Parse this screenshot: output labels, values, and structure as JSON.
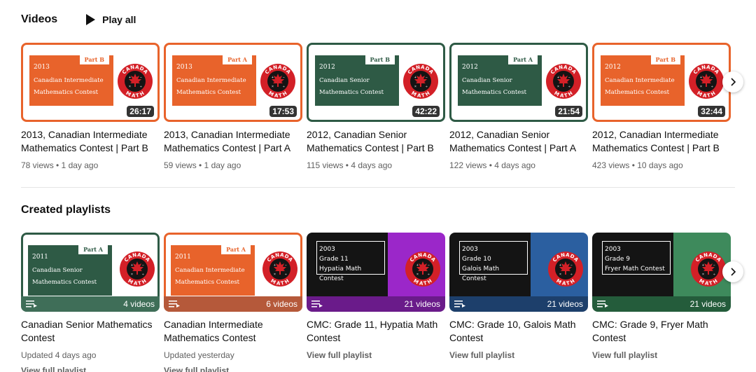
{
  "videos_section": {
    "title": "Videos",
    "play_all": "Play all",
    "items": [
      {
        "tag": "Part B",
        "year": "2013",
        "name": "Canadian Intermediate Mathematics Contest",
        "duration": "26:17",
        "title_line1": "2013, Canadian Intermediate",
        "title_line2": "Mathematics Contest | Part B",
        "meta": "78 views • 1 day ago",
        "theme": "orange"
      },
      {
        "tag": "Part A",
        "year": "2013",
        "name": "Canadian Intermediate Mathematics Contest",
        "duration": "17:53",
        "title_line1": "2013, Canadian Intermediate",
        "title_line2": "Mathematics Contest | Part A",
        "meta": "59 views • 1 day ago",
        "theme": "orange"
      },
      {
        "tag": "Part B",
        "year": "2012",
        "name": "Canadian Senior Mathematics Contest",
        "duration": "42:22",
        "title_line1": "2012, Canadian Senior",
        "title_line2": "Mathematics Contest | Part B",
        "meta": "115 views • 4 days ago",
        "theme": "green"
      },
      {
        "tag": "Part A",
        "year": "2012",
        "name": "Canadian Senior Mathematics Contest",
        "duration": "21:54",
        "title_line1": "2012, Canadian Senior",
        "title_line2": "Mathematics Contest | Part A",
        "meta": "122 views • 4 days ago",
        "theme": "green"
      },
      {
        "tag": "Part B",
        "year": "2012",
        "name": "Canadian Intermediate Mathematics Contest",
        "duration": "32:44",
        "title_line1": "2012, Canadian Intermediate",
        "title_line2": "Mathematics Contest | Part B",
        "meta": "423 views • 10 days ago",
        "theme": "orange"
      }
    ]
  },
  "playlists_section": {
    "title": "Created playlists",
    "items": [
      {
        "tag": "Part A",
        "year": "2011",
        "name": "Canadian Senior Mathematics Contest",
        "count": "4 videos",
        "title_line1": "Canadian Senior Mathematics",
        "title_line2": "Contest",
        "meta": "Updated 4 days ago",
        "link": "View full playlist",
        "theme": "green"
      },
      {
        "tag": "Part A",
        "year": "2011",
        "name": "Canadian Intermediate Mathematics Contest",
        "count": "6 videos",
        "title_line1": "Canadian Intermediate",
        "title_line2": "Mathematics Contest",
        "meta": "Updated yesterday",
        "link": "View full playlist",
        "theme": "orange"
      },
      {
        "label_line1": "2003",
        "label_line2": "Grade 11",
        "label_line3": "Hypatia Math Contest",
        "count": "21 videos",
        "title_line1": "CMC: Grade 11, Hypatia Math",
        "title_line2": "Contest",
        "link": "View full playlist",
        "color": "#9b27c9",
        "bar": "#6a1b8a"
      },
      {
        "label_line1": "2003",
        "label_line2": "Grade 10",
        "label_line3": "Galois Math Contest",
        "count": "21 videos",
        "title_line1": "CMC: Grade 10, Galois Math",
        "title_line2": "Contest",
        "link": "View full playlist",
        "color": "#2b5fa0",
        "bar": "#1d3f6b"
      },
      {
        "label_line1": "2003",
        "label_line2": "Grade 9",
        "label_line3": "Fryer Math Contest",
        "count": "21 videos",
        "title_line1": "CMC: Grade 9, Fryer Math",
        "title_line2": "Contest",
        "link": "View full playlist",
        "color": "#3e8a5c",
        "bar": "#245c3b"
      }
    ]
  },
  "logo_text": {
    "top": "CANADA",
    "bottom": "MATH"
  },
  "colors": {
    "orange": "#e8632b",
    "green": "#2e5a45",
    "logo_red": "#d32027"
  }
}
